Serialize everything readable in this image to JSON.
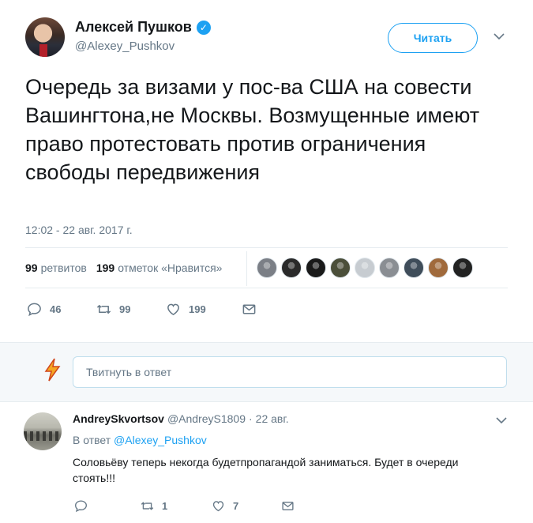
{
  "tweet": {
    "author_name": "Алексей Пушков",
    "author_handle": "@Alexey_Pushkov",
    "follow_label": "Читать",
    "text": "Очередь за визами у пос-ва США на совести Вашингтона,не Москвы. Возмущенные имеют право протестовать против ограничения свободы передвижения",
    "timestamp": "12:02 - 22 авг. 2017 г.",
    "retweets_count": "99",
    "retweets_label": "ретвитов",
    "likes_count": "199",
    "likes_label": "отметок «Нравится»",
    "actions": {
      "reply_count": "46",
      "retweet_count": "99",
      "like_count": "199"
    },
    "liker_colors": [
      "#7b7f86",
      "#2a2a2a",
      "#1a1a1a",
      "#4b4f3a",
      "#c7ccd1",
      "#8a8e93",
      "#3f4d5a",
      "#a06a3c",
      "#222222"
    ]
  },
  "reply_box": {
    "placeholder": "Твитнуть в ответ"
  },
  "reply": {
    "author_name": "AndreySkvortsov",
    "author_handle": "@AndreyS1809",
    "separator": "·",
    "date": "22 авг.",
    "in_reply_prefix": "В ответ",
    "in_reply_handle": "@Alexey_Pushkov",
    "text": "Соловьёву теперь некогда будетпропагандой заниматься. Будет в очереди стоять!!!",
    "actions": {
      "reply_count": "",
      "retweet_count": "1",
      "like_count": "7"
    }
  },
  "colors": {
    "accent": "#1da1f2",
    "muted": "#657786",
    "divider": "#e6ecf0"
  },
  "icons": [
    "verified-icon",
    "chevron-down-icon",
    "reply-icon",
    "retweet-icon",
    "like-icon",
    "message-icon",
    "user-avatar-icon"
  ]
}
